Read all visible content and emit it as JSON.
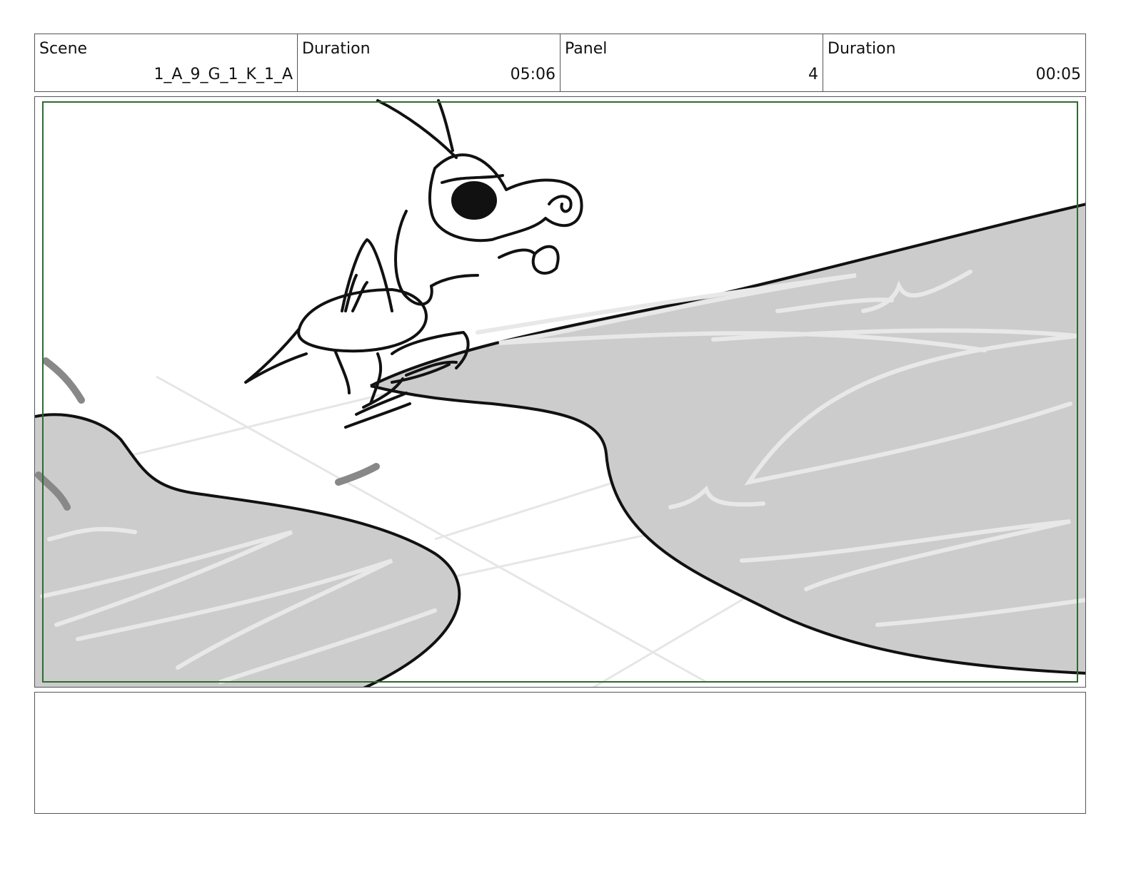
{
  "header": {
    "scene_label": "Scene",
    "scene_value": "1_A_9_G_1_K_1_A",
    "duration_label": "Duration",
    "duration_value": "05:06",
    "panel_label": "Panel",
    "panel_value": "4",
    "panel_duration_label": "Duration",
    "panel_duration_value": "00:05"
  },
  "colors": {
    "border": "#555555",
    "safe_frame": "#2e6b2e",
    "water": "#cccccc",
    "ink": "#111111"
  },
  "notes": {
    "text": ""
  }
}
